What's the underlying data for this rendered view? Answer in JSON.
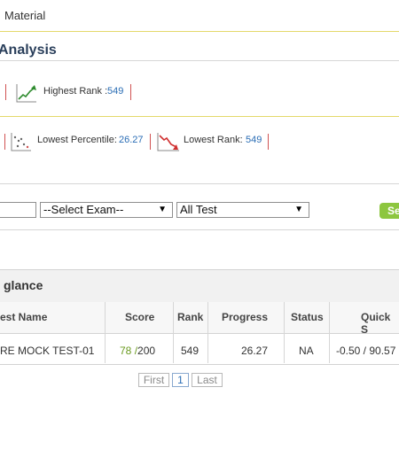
{
  "nav": {
    "material_label": "Material"
  },
  "analysis": {
    "title": "Analysis",
    "highest_rank_label": "Highest Rank :",
    "highest_rank_value": "549",
    "lowest_percentile_label": "Lowest Percentile:",
    "lowest_percentile_value": "26.27",
    "lowest_rank_label": "Lowest Rank:",
    "lowest_rank_value": "549"
  },
  "filters": {
    "text_input_value": "",
    "exam_select_value": "--Select Exam--",
    "test_select_value": "All Test",
    "search_button_label": "Se"
  },
  "glance": {
    "title": "glance",
    "columns": [
      "est Name",
      "Score",
      "Rank",
      "Progress",
      "Status",
      "Quick S"
    ],
    "rows": [
      {
        "test_name": "RE MOCK TEST-01",
        "score_obtained": "78",
        "score_sep": "/",
        "score_total": "200",
        "rank": "549",
        "progress": "26.27",
        "status": "NA",
        "quick": "-0.50 / 90.57"
      }
    ]
  },
  "pagination": {
    "first": "First",
    "page": "1",
    "last": "Last"
  },
  "colors": {
    "accent_blue": "#2a6db5",
    "score_green": "#6a9a1f",
    "button_green": "#8dc63f",
    "divider_yellow": "#e4d96a",
    "divider_red": "#d05252"
  },
  "icons": [
    "rank-up-chart-icon",
    "percentile-scatter-icon",
    "rank-down-chart-icon",
    "chevron-down-icon"
  ]
}
